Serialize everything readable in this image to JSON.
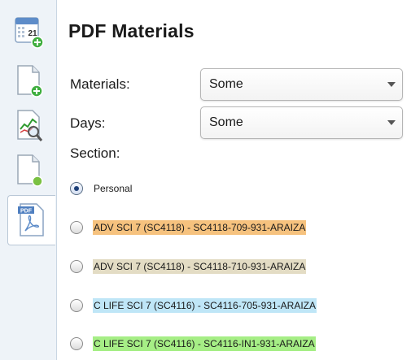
{
  "header": {
    "title": "PDF Materials"
  },
  "sidebar": {
    "items": [
      {
        "icon": "calendar-add-icon",
        "calendar_day": "21"
      },
      {
        "icon": "document-add-icon"
      },
      {
        "icon": "chart-search-icon"
      },
      {
        "icon": "document-status-icon"
      },
      {
        "icon": "pdf-icon",
        "badge": "PDF"
      }
    ]
  },
  "form": {
    "materials": {
      "label": "Materials:",
      "value": "Some"
    },
    "days": {
      "label": "Days:",
      "value": "Some"
    },
    "section": {
      "label": "Section:",
      "options": [
        {
          "label": "Personal",
          "selected": true,
          "color": ""
        },
        {
          "label": "ADV SCI 7 (SC4118) - SC4118-709-931-ARAIZA",
          "selected": false,
          "color": "#f6c27e"
        },
        {
          "label": "ADV SCI 7 (SC4118) - SC4118-710-931-ARAIZA",
          "selected": false,
          "color": "#e3dcc4"
        },
        {
          "label": "C LIFE SCI 7 (SC4116) - SC4116-705-931-ARAIZA",
          "selected": false,
          "color": "#bfe6f7"
        },
        {
          "label": "C LIFE SCI 7 (SC4116) - SC4116-IN1-931-ARAIZA",
          "selected": false,
          "color": "#a6ee86"
        }
      ]
    }
  }
}
